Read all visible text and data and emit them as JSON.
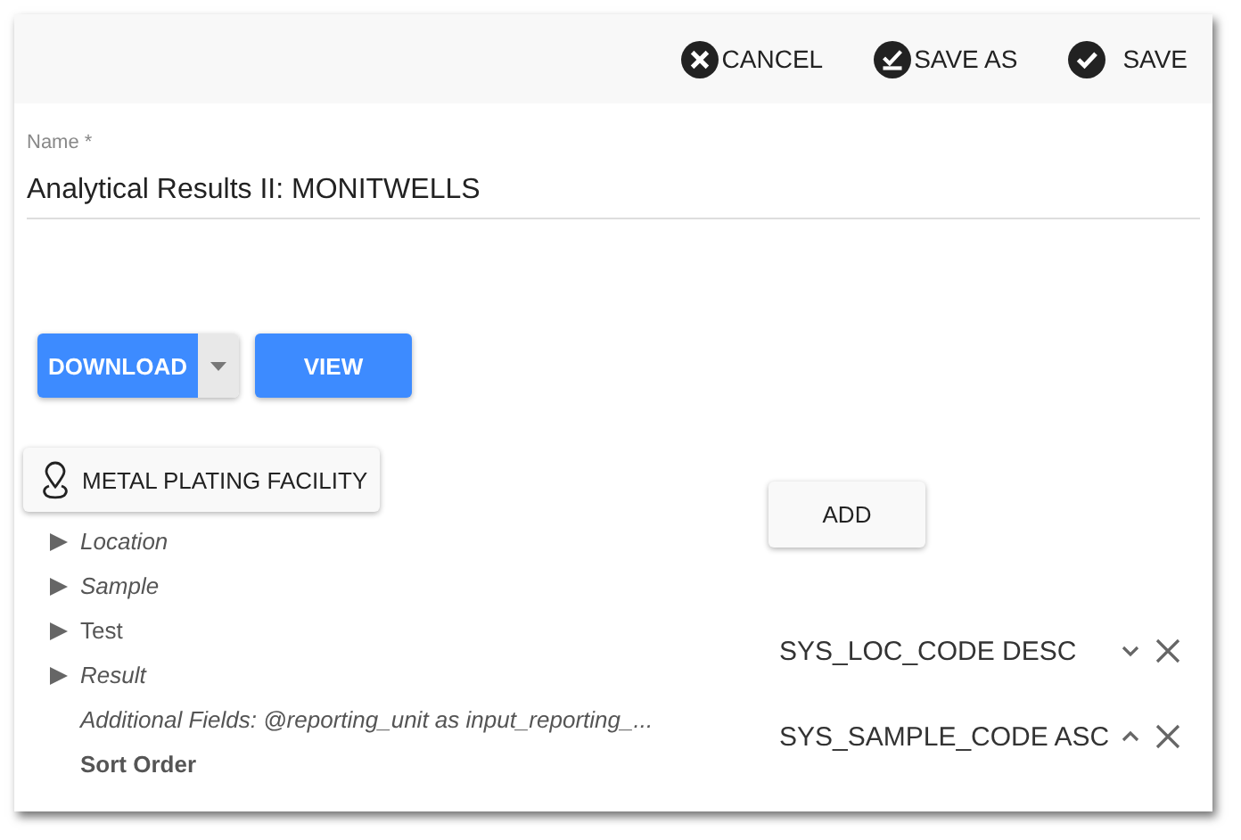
{
  "toolbar": {
    "buttons": [
      {
        "kind": "cancel",
        "label": "CANCEL"
      },
      {
        "kind": "save_as",
        "label": "SAVE AS"
      },
      {
        "kind": "save",
        "label": "SAVE"
      }
    ]
  },
  "name_field": {
    "label": "Name *",
    "value": "Analytical Results II: MONITWELLS"
  },
  "actions": {
    "download": "DOWNLOAD",
    "view": "VIEW"
  },
  "facility": "METAL PLATING FACILITY",
  "add_button": "ADD",
  "tree": [
    {
      "kind": "group",
      "label": "Location",
      "italic": true,
      "expanded": false
    },
    {
      "kind": "group",
      "label": "Sample",
      "italic": true,
      "expanded": false
    },
    {
      "kind": "group",
      "label": "Test",
      "italic": false,
      "expanded": false
    },
    {
      "kind": "group",
      "label": "Result",
      "italic": true,
      "expanded": false
    },
    {
      "kind": "note",
      "label": "Additional Fields: @reporting_unit as input_reporting_..."
    },
    {
      "kind": "heading",
      "label": "Sort Order"
    }
  ],
  "sort_order": [
    {
      "label": "SYS_LOC_CODE DESC",
      "ascending": false
    },
    {
      "label": "SYS_SAMPLE_CODE ASC",
      "ascending": true
    }
  ]
}
